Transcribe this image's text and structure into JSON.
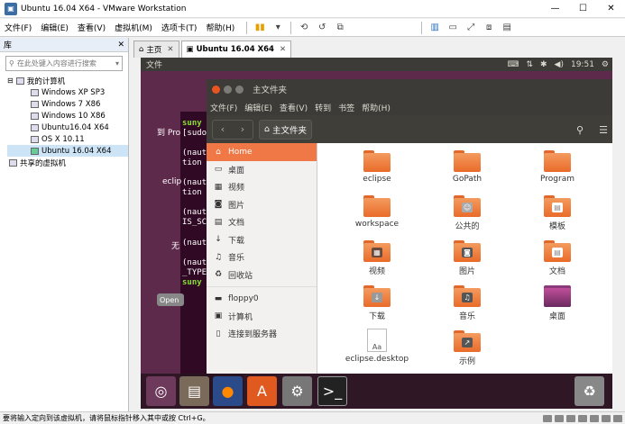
{
  "window": {
    "title": "Ubuntu 16.04 X64 - VMware Workstation"
  },
  "menubar": {
    "items": [
      "文件(F)",
      "编辑(E)",
      "查看(V)",
      "虚拟机(M)",
      "选项卡(T)",
      "帮助(H)"
    ]
  },
  "library": {
    "header": "库",
    "search_placeholder": "在此处键入内容进行搜索",
    "my_computer": "我的计算机",
    "vms": [
      "Windows XP SP3",
      "Windows 7 X86",
      "Windows 10 X86",
      "Ubuntu16.04 X64",
      "OS X 10.11",
      "Ubuntu 16.04 X64"
    ],
    "shared": "共享的虚拟机"
  },
  "tabs": [
    {
      "label": "主页"
    },
    {
      "label": "Ubuntu 16.04 X64"
    }
  ],
  "ubuntu": {
    "topbar_app": "文件",
    "clock": "19:51",
    "terminal_left": [
      "到 Pro",
      "eclip",
      "无"
    ],
    "terminal_lines": [
      "suny",
      "[sudo",
      "(naut",
      "tion",
      "(naut",
      "tion",
      "(naut",
      "IS_SC",
      "(naut",
      "(naut",
      "_TYPE",
      "suny"
    ],
    "open_label": "Open"
  },
  "nautilus": {
    "title": "主文件夹",
    "menu": [
      "文件(F)",
      "编辑(E)",
      "查看(V)",
      "转到",
      "书签",
      "帮助(H)"
    ],
    "path": "主文件夹",
    "sidebar": [
      {
        "icon": "home-icon",
        "label": "Home"
      },
      {
        "icon": "desktop-icon",
        "label": "桌面"
      },
      {
        "icon": "video-icon",
        "label": "视频"
      },
      {
        "icon": "camera-icon",
        "label": "图片"
      },
      {
        "icon": "document-icon",
        "label": "文档"
      },
      {
        "icon": "download-icon",
        "label": "下载"
      },
      {
        "icon": "music-icon",
        "label": "音乐"
      },
      {
        "icon": "trash-icon",
        "label": "回收站"
      }
    ],
    "devices": [
      {
        "icon": "drive-icon",
        "label": "floppy0"
      },
      {
        "icon": "computer-icon",
        "label": "计算机"
      },
      {
        "icon": "server-icon",
        "label": "连接到服务器"
      }
    ],
    "files": [
      "eclipse",
      "GoPath",
      "Program",
      "workspace",
      "公共的",
      "模板",
      "视频",
      "图片",
      "文档",
      "下载",
      "音乐",
      "桌面",
      "eclipse.desktop",
      "示例"
    ]
  },
  "statusbar": {
    "text": "要将输入定向到该虚拟机，请将鼠标指针移入其中或按 Ctrl+G。"
  }
}
